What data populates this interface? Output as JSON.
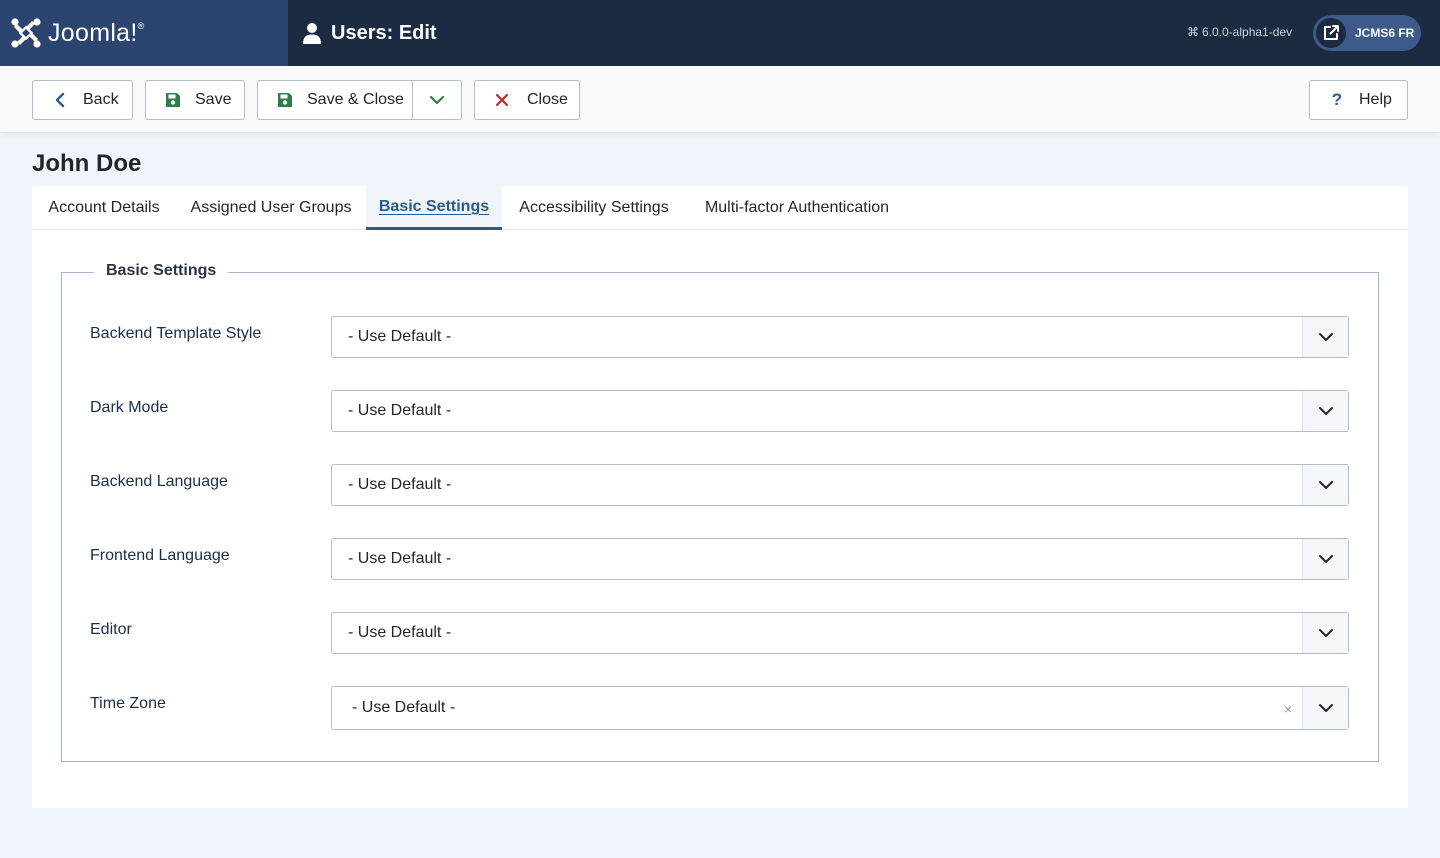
{
  "header": {
    "brand": "Joomla!",
    "page_title": "Users: Edit",
    "version": "6.0.0-alpha1-dev",
    "site_label": "JCMS6 FR"
  },
  "toolbar": {
    "back": "Back",
    "save": "Save",
    "save_close": "Save & Close",
    "close": "Close",
    "help": "Help"
  },
  "record": {
    "name": "John Doe"
  },
  "tabs": [
    {
      "label": "Account Details"
    },
    {
      "label": "Assigned User Groups"
    },
    {
      "label": "Basic Settings",
      "active": true
    },
    {
      "label": "Accessibility Settings"
    },
    {
      "label": "Multi-factor Authentication"
    }
  ],
  "fieldset": {
    "legend": "Basic Settings",
    "fields": [
      {
        "label": "Backend Template Style",
        "value": "- Use Default -"
      },
      {
        "label": "Dark Mode",
        "value": "- Use Default -"
      },
      {
        "label": "Backend Language",
        "value": "- Use Default -"
      },
      {
        "label": "Frontend Language",
        "value": "- Use Default -"
      },
      {
        "label": "Editor",
        "value": "- Use Default -"
      },
      {
        "label": "Time Zone",
        "value": "- Use Default -",
        "clear": "×"
      }
    ]
  },
  "colors": {
    "header_bg": "#1c2a42",
    "brand_bg": "#2c4470",
    "accent": "#2a5a8e",
    "save_green": "#2f7d4a",
    "close_red": "#c52827"
  },
  "icons": {
    "brand": "joomla-logo-icon",
    "user": "user-icon",
    "version": "command-key-icon",
    "site": "external-link-icon",
    "back": "chevron-left-icon",
    "save": "floppy-disk-icon",
    "dropdown": "chevron-down-icon",
    "close": "close-x-icon",
    "help": "question-mark-icon"
  }
}
